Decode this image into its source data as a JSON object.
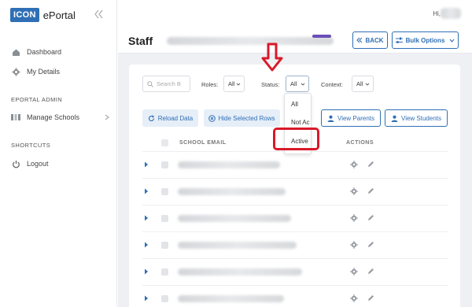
{
  "brand": {
    "badge": "ICON",
    "name": "ePortal"
  },
  "user": {
    "greeting": "Hi,"
  },
  "sidebar": {
    "items": [
      {
        "label": "Dashboard",
        "icon": "home-icon"
      },
      {
        "label": "My Details",
        "icon": "gear-icon"
      }
    ],
    "section_admin": "EPORTAL ADMIN",
    "admin_items": [
      {
        "label": "Manage Schools",
        "icon": "columns-icon"
      }
    ],
    "section_shortcuts": "SHORTCUTS",
    "shortcut_items": [
      {
        "label": "Logout",
        "icon": "power-icon"
      }
    ]
  },
  "header": {
    "title": "Staff",
    "back_label": "BACK",
    "bulk_label": "Bulk Options"
  },
  "filters": {
    "search_placeholder": "Search B",
    "roles_label": "Roles:",
    "roles_value": "All",
    "status_label": "Status:",
    "status_value": "All",
    "context_label": "Context:",
    "context_value": "All"
  },
  "actions": {
    "reload": "Reload Data",
    "hide_rows": "Hide Selected Rows",
    "view_parents": "View Parents",
    "view_students": "View Students"
  },
  "table": {
    "col_email": "SCHOOL EMAIL",
    "col_actions": "ACTIONS",
    "row_count": 6
  },
  "status_dropdown": {
    "options": [
      "All",
      "Not Ac",
      "Active"
    ],
    "highlighted": "Active"
  },
  "colors": {
    "primary": "#2f6fb5",
    "annotation": "#d9192a",
    "main_bg": "#eef0f4"
  }
}
